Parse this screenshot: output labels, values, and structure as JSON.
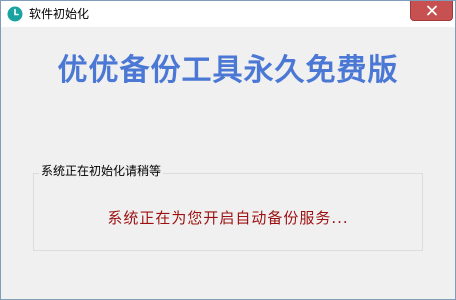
{
  "window": {
    "title": "软件初始化",
    "close_symbol": "✕"
  },
  "main": {
    "headline": "优优备份工具永久免费版",
    "group_label": "系统正在初始化请稍等",
    "status_text": "系统正在为您开启自动备份服务..."
  },
  "icons": {
    "app": "clock-icon",
    "close": "close-icon"
  },
  "colors": {
    "headline": "#4a78d4",
    "status_text": "#9b1010",
    "close_button": "#c75050",
    "app_icon": "#1aa3a0",
    "window_bg": "#f0f0f0"
  }
}
